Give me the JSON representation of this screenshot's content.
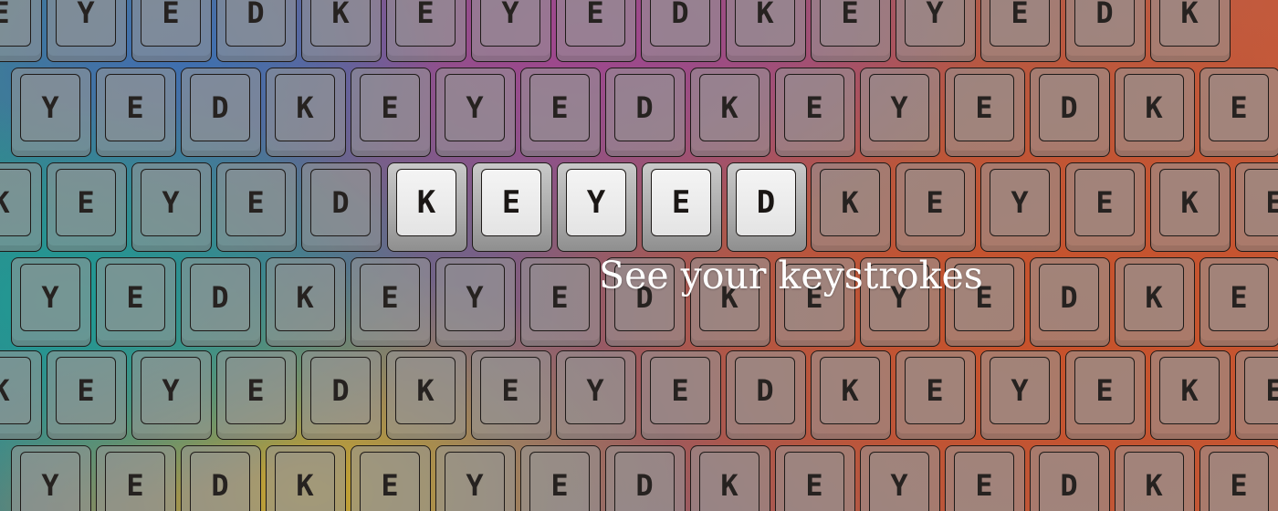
{
  "background_colors": {
    "teal": "#1f9a92",
    "mustard": "#c8a52c",
    "blue": "#3f6fb0",
    "magenta": "#a0468e",
    "orange": "#c8522a"
  },
  "hero": {
    "letters": [
      "K",
      "E",
      "Y",
      "E",
      "D"
    ]
  },
  "tagline": "See your keystrokes",
  "background_rows": [
    [
      "E",
      "Y",
      "E",
      "D",
      "K",
      "E",
      "Y",
      "E",
      "D",
      "K",
      "E",
      "Y",
      "E",
      "D",
      "K"
    ],
    [
      "Y",
      "E",
      "D",
      "K",
      "E",
      "Y",
      "E",
      "D",
      "K",
      "E",
      "Y",
      "E",
      "D",
      "K",
      "E"
    ],
    [
      "K",
      "E",
      "Y",
      "E",
      "D",
      "K",
      "E",
      "Y",
      "E",
      "D",
      "K",
      "E",
      "Y",
      "E",
      "K",
      "E"
    ],
    [
      "Y",
      "E",
      "D",
      "K",
      "E",
      "Y",
      "E",
      "D",
      "K",
      "E",
      "Y",
      "E",
      "D",
      "K",
      "E"
    ],
    [
      "K",
      "E",
      "Y",
      "E",
      "D",
      "K",
      "E",
      "Y",
      "E",
      "D",
      "K",
      "E",
      "Y",
      "E",
      "K",
      "E"
    ],
    [
      "Y",
      "E",
      "D",
      "K",
      "E",
      "Y",
      "E",
      "D",
      "K",
      "E",
      "Y",
      "E",
      "D",
      "K",
      "E"
    ]
  ]
}
